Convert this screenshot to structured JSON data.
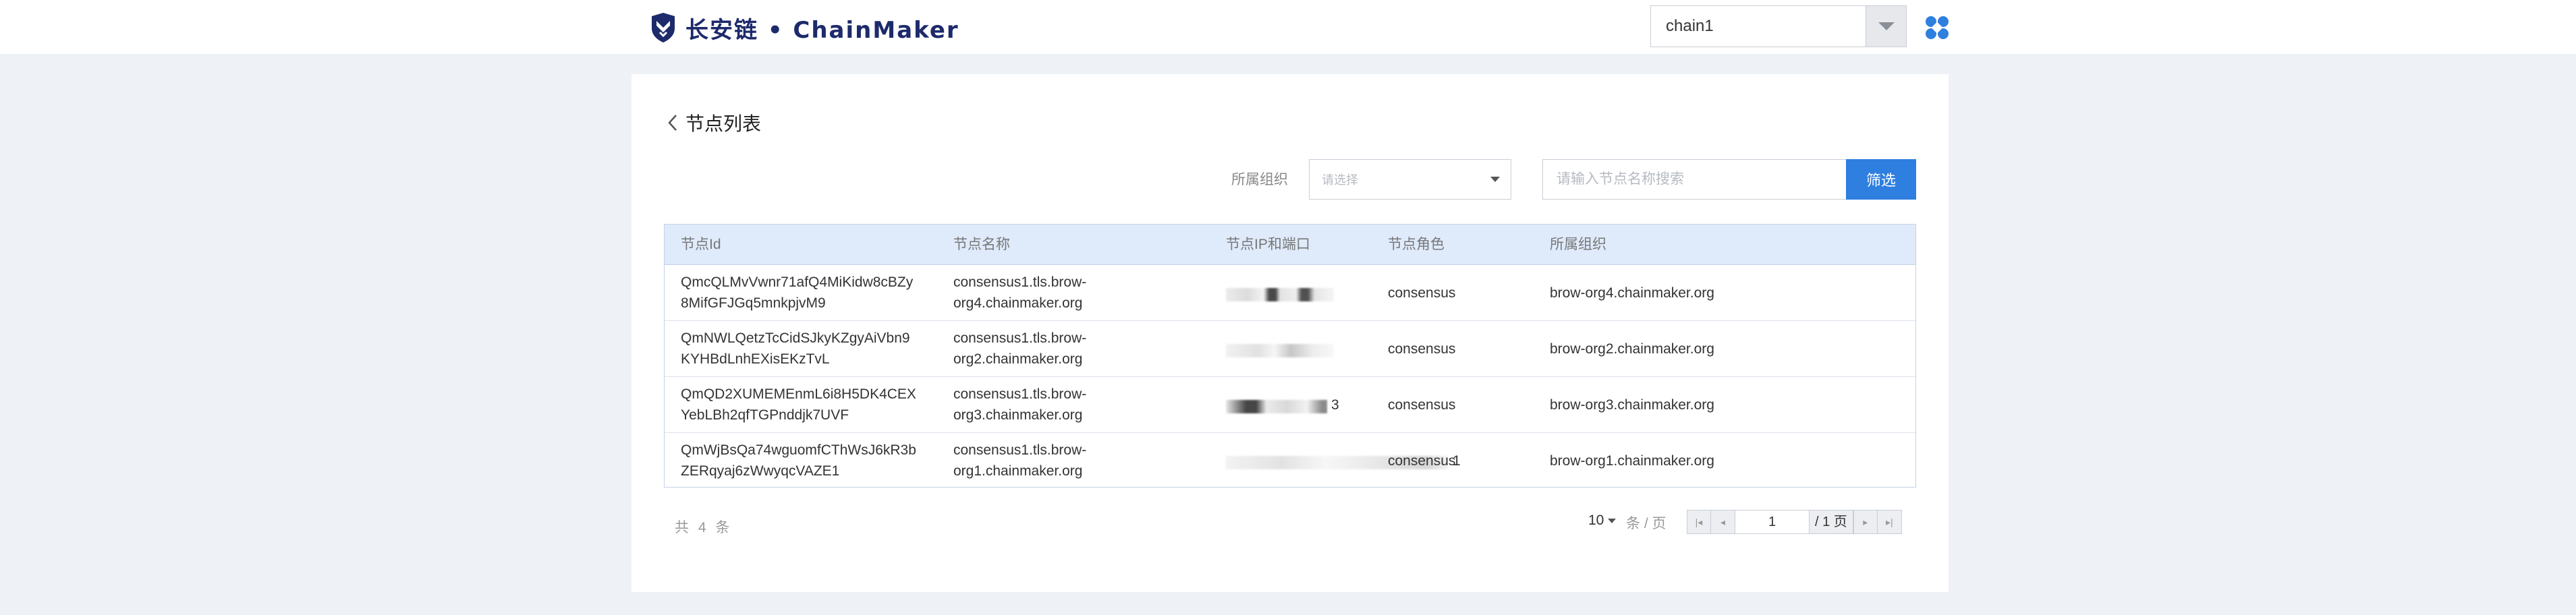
{
  "header": {
    "logo_text": "长安链 • ChainMaker",
    "chain_select_value": "chain1"
  },
  "page": {
    "title": "节点列表",
    "filter": {
      "org_label": "所属组织",
      "org_placeholder": "请选择",
      "search_placeholder": "请输入节点名称搜索",
      "filter_button": "筛选"
    },
    "table": {
      "columns": [
        "节点Id",
        "节点名称",
        "节点IP和端口",
        "节点角色",
        "所属组织"
      ],
      "rows": [
        {
          "id_line1": "QmcQLMvVwnr71afQ4MiKidw8cBZy",
          "id_line2": "8MifGFJGq5mnkpjvM9",
          "name_line1": "consensus1.tls.brow-",
          "name_line2": "org4.chainmaker.org",
          "ip_tail": "",
          "role": "consensus",
          "org": "brow-org4.chainmaker.org"
        },
        {
          "id_line1": "QmNWLQetzTcCidSJkyKZgyAiVbn9",
          "id_line2": "KYHBdLnhEXisEKzTvL",
          "name_line1": "consensus1.tls.brow-",
          "name_line2": "org2.chainmaker.org",
          "ip_tail": "",
          "role": "consensus",
          "org": "brow-org2.chainmaker.org"
        },
        {
          "id_line1": "QmQD2XUMEMEnmL6i8H5DK4CEX",
          "id_line2": "YebLBh2qfTGPnddjk7UVF",
          "name_line1": "consensus1.tls.brow-",
          "name_line2": "org3.chainmaker.org",
          "ip_tail": "3",
          "role": "consensus",
          "org": "brow-org3.chainmaker.org"
        },
        {
          "id_line1": "QmWjBsQa74wguomfCThWsJ6kR3b",
          "id_line2": "ZERqyaj6zWwyqcVAZE1",
          "name_line1": "consensus1.tls.brow-",
          "name_line2": "org1.chainmaker.org",
          "ip_tail": "1",
          "role": "consensus",
          "org": "brow-org1.chainmaker.org"
        }
      ]
    },
    "pagination": {
      "total_text": "共 4 条",
      "page_size": "10",
      "per_page_text": "条 / 页",
      "current_page": "1",
      "total_pages_text": "/ 1 页"
    }
  },
  "colors": {
    "accent": "#2e7fe0",
    "header_row": "#dfeafb",
    "background": "#eef1f6",
    "logo": "#1d2a6b"
  }
}
